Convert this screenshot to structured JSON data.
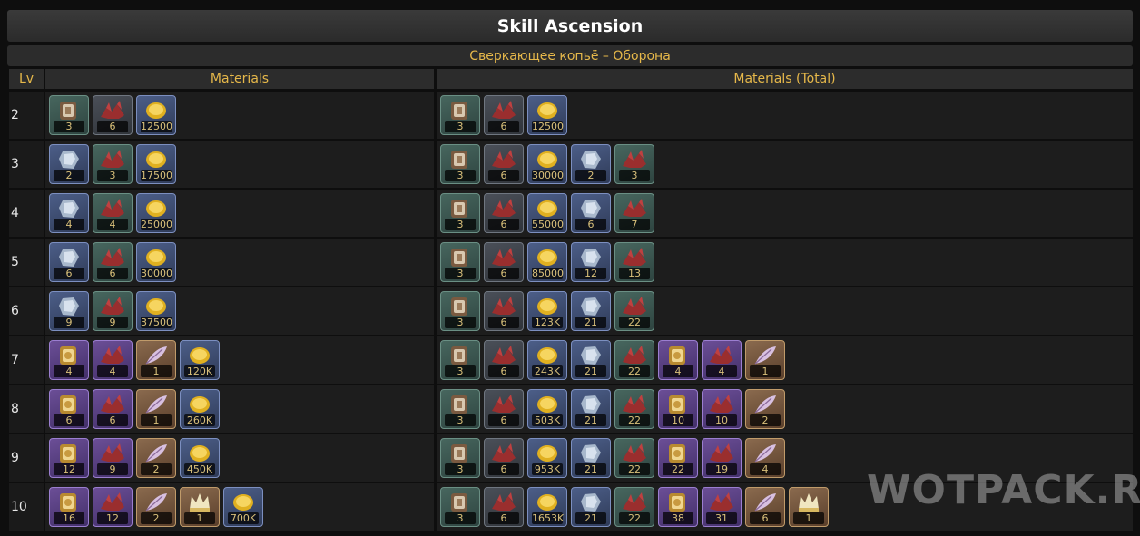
{
  "title": "Skill Ascension",
  "subtitle": "Сверкающее копьё – Оборона",
  "headers": {
    "lv": "Lv",
    "materials": "Materials",
    "total": "Materials (Total)"
  },
  "watermark": "WOTPACK.RU",
  "colors": {
    "accent": "#e6b84a",
    "title": "#ffffff",
    "background": "#0e0e0e"
  },
  "rows": [
    {
      "lv": "2",
      "materials": [
        {
          "icon": "tome-icon",
          "frame": "green",
          "count": "3"
        },
        {
          "icon": "ore-icon",
          "frame": "grey",
          "count": "6"
        },
        {
          "icon": "coin-icon",
          "frame": "blue",
          "count": "12500"
        }
      ],
      "total": [
        {
          "icon": "tome-icon",
          "frame": "green",
          "count": "3"
        },
        {
          "icon": "ore-icon",
          "frame": "grey",
          "count": "6"
        },
        {
          "icon": "coin-icon",
          "frame": "blue",
          "count": "12500"
        }
      ]
    },
    {
      "lv": "3",
      "materials": [
        {
          "icon": "crystal-icon",
          "frame": "blue",
          "count": "2"
        },
        {
          "icon": "ore-icon",
          "frame": "green",
          "count": "3"
        },
        {
          "icon": "coin-icon",
          "frame": "blue",
          "count": "17500"
        }
      ],
      "total": [
        {
          "icon": "tome-icon",
          "frame": "green",
          "count": "3"
        },
        {
          "icon": "ore-icon",
          "frame": "grey",
          "count": "6"
        },
        {
          "icon": "coin-icon",
          "frame": "blue",
          "count": "30000"
        },
        {
          "icon": "crystal-icon",
          "frame": "blue",
          "count": "2"
        },
        {
          "icon": "ore-icon",
          "frame": "green",
          "count": "3"
        }
      ]
    },
    {
      "lv": "4",
      "materials": [
        {
          "icon": "crystal-icon",
          "frame": "blue",
          "count": "4"
        },
        {
          "icon": "ore-icon",
          "frame": "green",
          "count": "4"
        },
        {
          "icon": "coin-icon",
          "frame": "blue",
          "count": "25000"
        }
      ],
      "total": [
        {
          "icon": "tome-icon",
          "frame": "green",
          "count": "3"
        },
        {
          "icon": "ore-icon",
          "frame": "grey",
          "count": "6"
        },
        {
          "icon": "coin-icon",
          "frame": "blue",
          "count": "55000"
        },
        {
          "icon": "crystal-icon",
          "frame": "blue",
          "count": "6"
        },
        {
          "icon": "ore-icon",
          "frame": "green",
          "count": "7"
        }
      ]
    },
    {
      "lv": "5",
      "materials": [
        {
          "icon": "crystal-icon",
          "frame": "blue",
          "count": "6"
        },
        {
          "icon": "ore-icon",
          "frame": "green",
          "count": "6"
        },
        {
          "icon": "coin-icon",
          "frame": "blue",
          "count": "30000"
        }
      ],
      "total": [
        {
          "icon": "tome-icon",
          "frame": "green",
          "count": "3"
        },
        {
          "icon": "ore-icon",
          "frame": "grey",
          "count": "6"
        },
        {
          "icon": "coin-icon",
          "frame": "blue",
          "count": "85000"
        },
        {
          "icon": "crystal-icon",
          "frame": "blue",
          "count": "12"
        },
        {
          "icon": "ore-icon",
          "frame": "green",
          "count": "13"
        }
      ]
    },
    {
      "lv": "6",
      "materials": [
        {
          "icon": "crystal-icon",
          "frame": "blue",
          "count": "9"
        },
        {
          "icon": "ore-icon",
          "frame": "green",
          "count": "9"
        },
        {
          "icon": "coin-icon",
          "frame": "blue",
          "count": "37500"
        }
      ],
      "total": [
        {
          "icon": "tome-icon",
          "frame": "green",
          "count": "3"
        },
        {
          "icon": "ore-icon",
          "frame": "grey",
          "count": "6"
        },
        {
          "icon": "coin-icon",
          "frame": "blue",
          "count": "123K"
        },
        {
          "icon": "crystal-icon",
          "frame": "blue",
          "count": "21"
        },
        {
          "icon": "ore-icon",
          "frame": "green",
          "count": "22"
        }
      ]
    },
    {
      "lv": "7",
      "materials": [
        {
          "icon": "gold-tome-icon",
          "frame": "purple",
          "count": "4"
        },
        {
          "icon": "ore-icon",
          "frame": "purple",
          "count": "4"
        },
        {
          "icon": "feather-icon",
          "frame": "gold",
          "count": "1"
        },
        {
          "icon": "coin-icon",
          "frame": "blue",
          "count": "120K"
        }
      ],
      "total": [
        {
          "icon": "tome-icon",
          "frame": "green",
          "count": "3"
        },
        {
          "icon": "ore-icon",
          "frame": "grey",
          "count": "6"
        },
        {
          "icon": "coin-icon",
          "frame": "blue",
          "count": "243K"
        },
        {
          "icon": "crystal-icon",
          "frame": "blue",
          "count": "21"
        },
        {
          "icon": "ore-icon",
          "frame": "green",
          "count": "22"
        },
        {
          "icon": "gold-tome-icon",
          "frame": "purple",
          "count": "4"
        },
        {
          "icon": "ore-icon",
          "frame": "purple",
          "count": "4"
        },
        {
          "icon": "feather-icon",
          "frame": "gold",
          "count": "1"
        }
      ]
    },
    {
      "lv": "8",
      "materials": [
        {
          "icon": "gold-tome-icon",
          "frame": "purple",
          "count": "6"
        },
        {
          "icon": "ore-icon",
          "frame": "purple",
          "count": "6"
        },
        {
          "icon": "feather-icon",
          "frame": "gold",
          "count": "1"
        },
        {
          "icon": "coin-icon",
          "frame": "blue",
          "count": "260K"
        }
      ],
      "total": [
        {
          "icon": "tome-icon",
          "frame": "green",
          "count": "3"
        },
        {
          "icon": "ore-icon",
          "frame": "grey",
          "count": "6"
        },
        {
          "icon": "coin-icon",
          "frame": "blue",
          "count": "503K"
        },
        {
          "icon": "crystal-icon",
          "frame": "blue",
          "count": "21"
        },
        {
          "icon": "ore-icon",
          "frame": "green",
          "count": "22"
        },
        {
          "icon": "gold-tome-icon",
          "frame": "purple",
          "count": "10"
        },
        {
          "icon": "ore-icon",
          "frame": "purple",
          "count": "10"
        },
        {
          "icon": "feather-icon",
          "frame": "gold",
          "count": "2"
        }
      ]
    },
    {
      "lv": "9",
      "materials": [
        {
          "icon": "gold-tome-icon",
          "frame": "purple",
          "count": "12"
        },
        {
          "icon": "ore-icon",
          "frame": "purple",
          "count": "9"
        },
        {
          "icon": "feather-icon",
          "frame": "gold",
          "count": "2"
        },
        {
          "icon": "coin-icon",
          "frame": "blue",
          "count": "450K"
        }
      ],
      "total": [
        {
          "icon": "tome-icon",
          "frame": "green",
          "count": "3"
        },
        {
          "icon": "ore-icon",
          "frame": "grey",
          "count": "6"
        },
        {
          "icon": "coin-icon",
          "frame": "blue",
          "count": "953K"
        },
        {
          "icon": "crystal-icon",
          "frame": "blue",
          "count": "21"
        },
        {
          "icon": "ore-icon",
          "frame": "green",
          "count": "22"
        },
        {
          "icon": "gold-tome-icon",
          "frame": "purple",
          "count": "22"
        },
        {
          "icon": "ore-icon",
          "frame": "purple",
          "count": "19"
        },
        {
          "icon": "feather-icon",
          "frame": "gold",
          "count": "4"
        }
      ]
    },
    {
      "lv": "10",
      "materials": [
        {
          "icon": "gold-tome-icon",
          "frame": "purple",
          "count": "16"
        },
        {
          "icon": "ore-icon",
          "frame": "purple",
          "count": "12"
        },
        {
          "icon": "feather-icon",
          "frame": "gold",
          "count": "2"
        },
        {
          "icon": "crown-icon",
          "frame": "gold",
          "count": "1"
        },
        {
          "icon": "coin-icon",
          "frame": "blue",
          "count": "700K"
        }
      ],
      "total": [
        {
          "icon": "tome-icon",
          "frame": "green",
          "count": "3"
        },
        {
          "icon": "ore-icon",
          "frame": "grey",
          "count": "6"
        },
        {
          "icon": "coin-icon",
          "frame": "blue",
          "count": "1653K"
        },
        {
          "icon": "crystal-icon",
          "frame": "blue",
          "count": "21"
        },
        {
          "icon": "ore-icon",
          "frame": "green",
          "count": "22"
        },
        {
          "icon": "gold-tome-icon",
          "frame": "purple",
          "count": "38"
        },
        {
          "icon": "ore-icon",
          "frame": "purple",
          "count": "31"
        },
        {
          "icon": "feather-icon",
          "frame": "gold",
          "count": "6"
        },
        {
          "icon": "crown-icon",
          "frame": "gold",
          "count": "1"
        }
      ]
    }
  ]
}
